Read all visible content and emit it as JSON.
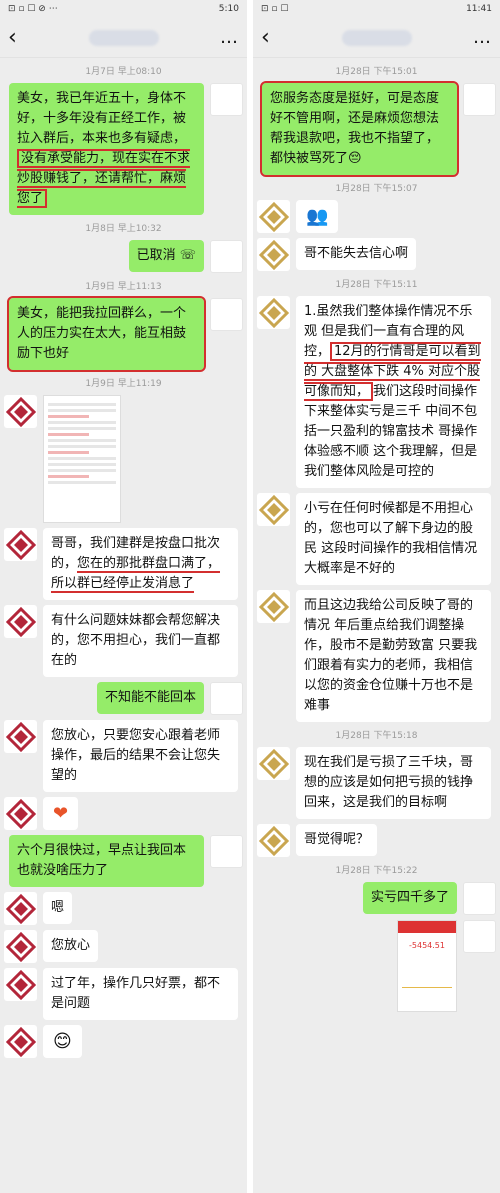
{
  "left": {
    "status": {
      "left": "⊡ ▫ ☐ ⊘ ⋯",
      "right": "5:10"
    },
    "nav": {
      "back": "‹",
      "more": "…"
    },
    "messages": {
      "t1": "1月7日 早上08:10",
      "m1a": "美女，我已年近五十，身体不好，十多年没有正经工作，被拉入群后，本来也多有疑虑，",
      "m1b": "没有承受能力，现在实在不求炒股赚钱了，还请帮忙，麻烦您了",
      "t2": "1月8日 早上10:32",
      "m2": "已取消",
      "t3": "1月9日 早上11:13",
      "m3": "美女，能把我拉回群么，一个人的压力实在太大，能互相鼓励下也好",
      "t4": "1月9日 早上11:19",
      "m4a": "哥哥，我们建群是按盘口批次的，",
      "m4b": "您在的那批群盘口满了，",
      "m4c": "所以群已经停止发消息了",
      "m5": "有什么问题妹妹都会帮您解决的，您不用担心，我们一直都在的",
      "m6": "不知能不能回本",
      "m7": "您放心，只要您安心跟着老师操作，最后的结果不会让您失望的",
      "m8": "❤",
      "m9": "六个月很快过，早点让我回本也就没啥压力了",
      "m10": "嗯",
      "m11": "您放心",
      "m12": "过了年，操作几只好票，都不是问题",
      "m13": "😊"
    }
  },
  "right": {
    "status": {
      "left": "⊡ ▫ ☐",
      "right": "11:41"
    },
    "nav": {
      "back": "‹",
      "more": "…"
    },
    "messages": {
      "t1": "1月28日 下午15:01",
      "m1": "您服务态度是挺好，可是态度好不管用啊，还是麻烦您想法帮我退款吧，我也不指望了，都快被骂死了😔",
      "t2": "1月28日 下午15:07",
      "m2": "👥",
      "m3": "哥不能失去信心啊",
      "t3": "1月28日 下午15:11",
      "m4a": "1.虽然我们整体操作情况不乐观 但是我们一直有合理的风控，",
      "m4b": "12月的行情哥是可以看到的 大盘整体下跌 4% 对应个股可像而知，",
      "m4c": "我们这段时间操作下来整体实亏是三千 中间不包括一只盈利的锦富技术 哥操作体验感不顺 这个我理解，但是我们整体风险是可控的",
      "m5": "小亏在任何时候都是不用担心的，您也可以了解下身边的股民 这段时间操作的我相信情况大概率是不好的",
      "m6": "而且这边我给公司反映了哥的情况 年后重点给我们调整操作，股市不是勤劳致富 只要我们跟着有实力的老师，我相信以您的资金仓位赚十万也不是难事",
      "t4": "1月28日 下午15:18",
      "m7": "现在我们是亏损了三千块，哥想的应该是如何把亏损的钱挣回来，这是我们的目标啊",
      "m8": "哥觉得呢？",
      "t5": "1月28日 下午15:22",
      "m9": "实亏四千多了",
      "m10": "-5454.51"
    }
  },
  "colors": {
    "bubble_green": "#95ec69",
    "highlight_red": "#d32f2f",
    "bg": "#ededed"
  }
}
